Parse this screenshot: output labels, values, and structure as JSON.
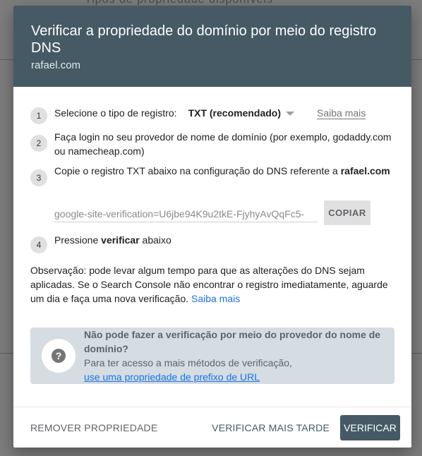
{
  "background": {
    "partial_text": "Tipos de propriedade disponíveis"
  },
  "dialog": {
    "title": "Verificar a propriedade do domínio por meio do registro DNS",
    "subtitle": "rafael.com",
    "steps": [
      {
        "number": "1",
        "label": "Selecione o tipo de registro:",
        "record_type": "TXT (recomendado)",
        "learn_more": "Saiba mais"
      },
      {
        "number": "2",
        "text": "Faça login no seu provedor de nome de domínio (por exemplo, godaddy.com ou namecheap.com)"
      },
      {
        "number": "3",
        "text_before": "Copie o registro TXT abaixo na configuração do DNS referente a ",
        "domain": "rafael.com",
        "txt_value": "google-site-verification=U6jbe94K9u2tkE-FjyhyAvQqFc5-",
        "copy_label": "COPIAR"
      },
      {
        "number": "4",
        "text_before": "Pressione ",
        "bold": "verificar",
        "text_after": " abaixo"
      }
    ],
    "note": "Observação: pode levar algum tempo para que as alterações do DNS sejam aplicadas. Se o Search Console não encontrar o registro imediatamente, aguarde um dia e faça uma nova verificação.",
    "note_link": "Saiba mais",
    "alternative": {
      "icon": "help-icon",
      "title": "Não pode fazer a verificação por meio do provedor do nome de domínio?",
      "description": "Para ter acesso a mais métodos de verificação,",
      "link": "use uma propriedade de prefixo de URL"
    },
    "footer": {
      "remove_label": "REMOVER PROPRIEDADE",
      "later_label": "VERIFICAR MAIS TARDE",
      "verify_label": "VERIFICAR"
    }
  },
  "colors": {
    "header_bg": "#455a64",
    "link": "#1a73e8",
    "alt_box_bg": "#d5dde2"
  }
}
